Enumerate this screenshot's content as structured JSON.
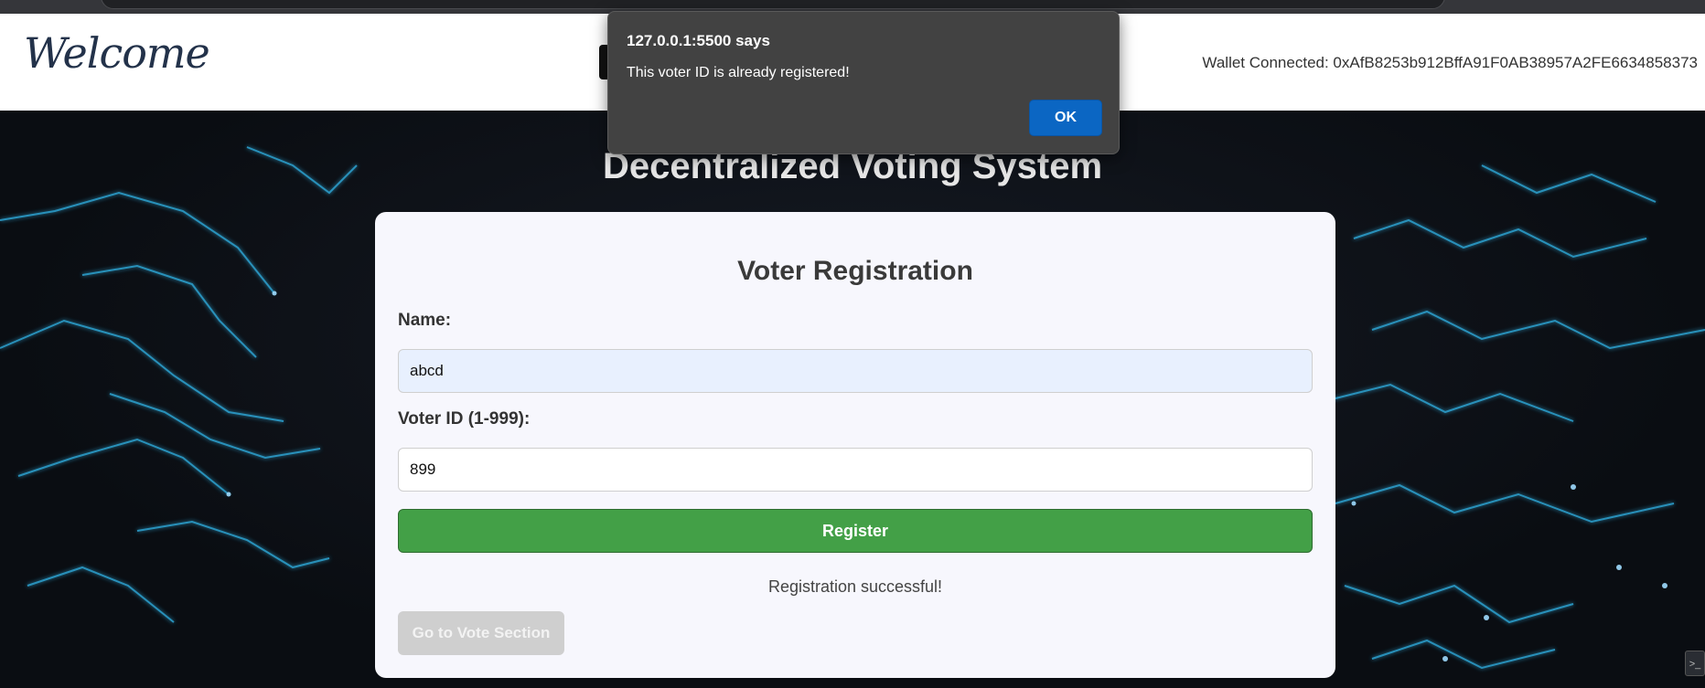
{
  "header": {
    "logo_text": "Welcome",
    "wallet_text": "Wallet Connected: 0xAfB8253b912BffA91F0AB38957A2FE6634858373"
  },
  "page": {
    "title": "Decentralized Voting System"
  },
  "form": {
    "heading": "Voter Registration",
    "name_label": "Name:",
    "name_value": "abcd",
    "voter_id_label": "Voter ID (1-999):",
    "voter_id_value": "899",
    "register_label": "Register",
    "status_message": "Registration successful!",
    "vote_section_label": "Go to Vote Section"
  },
  "dialog": {
    "origin": "127.0.0.1:5500 says",
    "message": "This voter ID is already registered!",
    "ok_label": "OK"
  },
  "colors": {
    "register_green": "#43a047",
    "dialog_ok_blue": "#0b66c3",
    "dialog_bg": "#424242",
    "disabled_button": "#cfcfcf"
  }
}
